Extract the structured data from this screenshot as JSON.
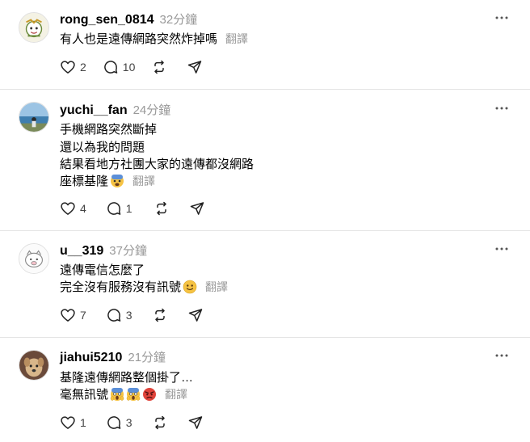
{
  "more_symbol": "···",
  "posts": [
    {
      "username": "rong_sen_0814",
      "time": "32分鐘",
      "lines": [
        "有人也是遠傳網路突然炸掉嗎"
      ],
      "translate": "翻譯",
      "likes": "2",
      "replies": "10",
      "avatar": "drawing-avatar"
    },
    {
      "username": "yuchi__fan",
      "time": "24分鐘",
      "lines": [
        "手機網路突然斷掉",
        "還以為我的問題",
        "結果看地方社團大家的遠傳都沒網路",
        "座標基隆"
      ],
      "translate": "翻譯",
      "likes": "4",
      "replies": "1",
      "avatar": "ocean-photo-avatar",
      "emoji": [
        "fearful-face"
      ]
    },
    {
      "username": "u__319",
      "time": "37分鐘",
      "lines": [
        "遠傳電信怎麼了",
        "完全沒有服務沒有訊號"
      ],
      "translate": "翻譯",
      "likes": "7",
      "replies": "3",
      "avatar": "cartoon-pig-avatar",
      "emoji": [
        "slightly-smiling-face"
      ]
    },
    {
      "username": "jiahui5210",
      "time": "21分鐘",
      "lines": [
        "基隆遠傳網路整個掛了…",
        "毫無訊號"
      ],
      "translate": "翻譯",
      "likes": "1",
      "replies": "3",
      "avatar": "dog-photo-avatar",
      "emoji": [
        "screaming-face",
        "screaming-face",
        "angry-face"
      ]
    }
  ]
}
